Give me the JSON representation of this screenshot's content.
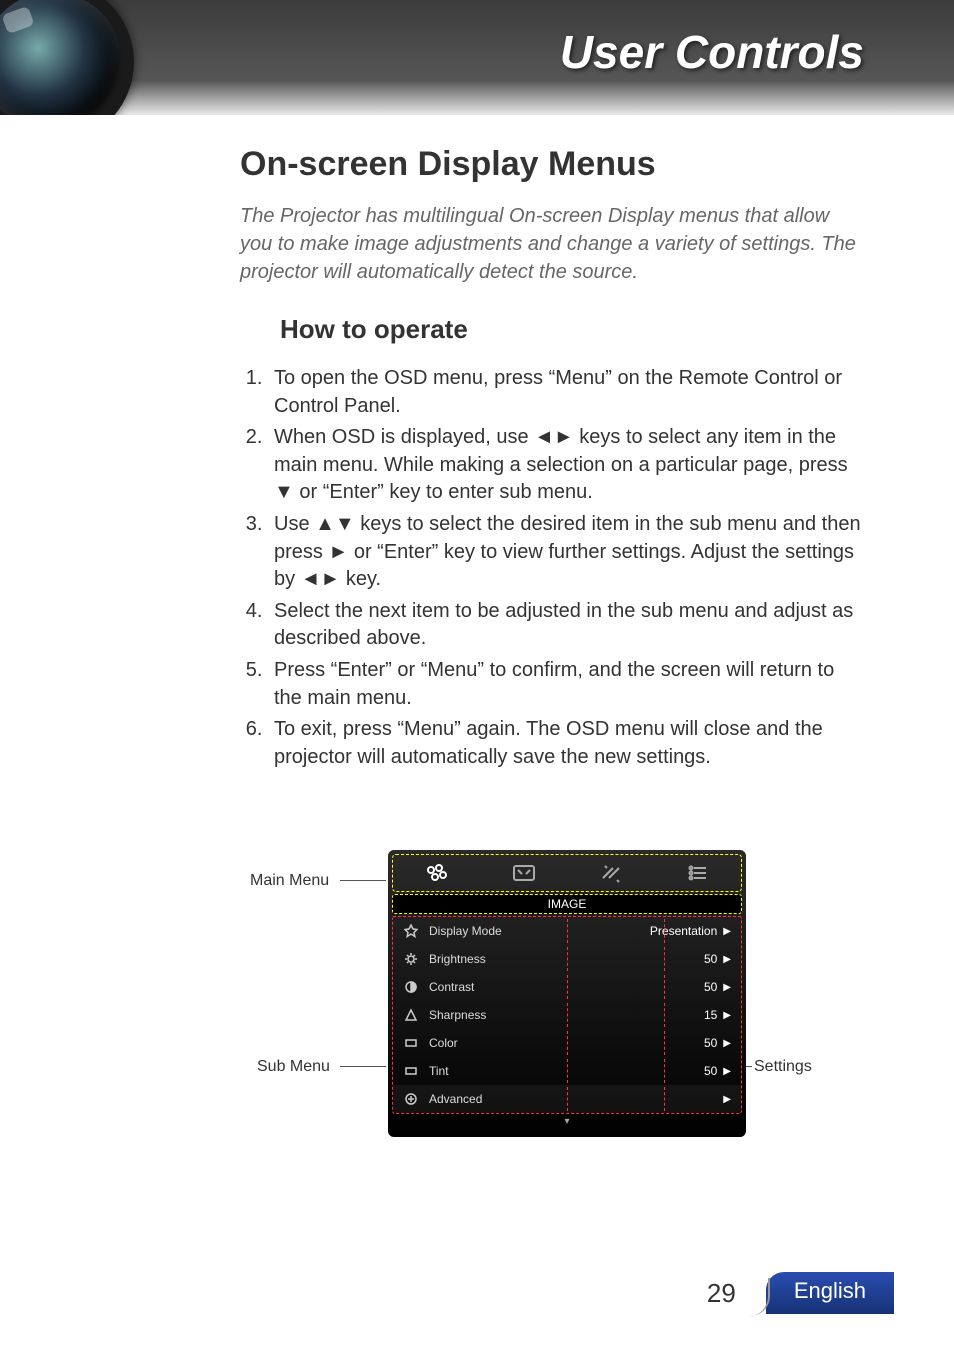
{
  "header": {
    "title": "User Controls"
  },
  "section": {
    "title": "On-screen Display Menus",
    "intro": "The Projector has multilingual On-screen Display menus that allow you to make image adjustments and change a variety of settings. The projector will automatically detect the source.",
    "howto_title": "How to operate",
    "steps": [
      "To open the OSD menu, press “Menu” on the Remote Control or Control Panel.",
      "When OSD is displayed, use ◄► keys to select any item in the main menu. While making a selection on a particular page, press ▼ or “Enter” key to enter sub menu.",
      "Use ▲▼ keys to select the desired item in the sub menu and then press ► or “Enter” key to view further settings. Adjust the settings by ◄► key.",
      "Select the next item to be adjusted in the sub menu and adjust as described above.",
      "Press “Enter” or “Menu” to confirm, and the screen will return to the main menu.",
      "To exit, press “Menu” again. The OSD menu will close and the projector will automatically save the new settings."
    ]
  },
  "labels": {
    "main_menu": "Main Menu",
    "sub_menu": "Sub Menu",
    "settings": "Settings"
  },
  "osd": {
    "title": "IMAGE",
    "rows": [
      {
        "icon": "star",
        "label": "Display Mode",
        "value": "Presentation"
      },
      {
        "icon": "gear",
        "label": "Brightness",
        "value": "50"
      },
      {
        "icon": "contrast",
        "label": "Contrast",
        "value": "50"
      },
      {
        "icon": "delta",
        "label": "Sharpness",
        "value": "15"
      },
      {
        "icon": "rect",
        "label": "Color",
        "value": "50"
      },
      {
        "icon": "rect",
        "label": "Tint",
        "value": "50"
      },
      {
        "icon": "plus",
        "label": "Advanced",
        "value": ""
      }
    ]
  },
  "footer": {
    "page": "29",
    "lang": "English"
  }
}
